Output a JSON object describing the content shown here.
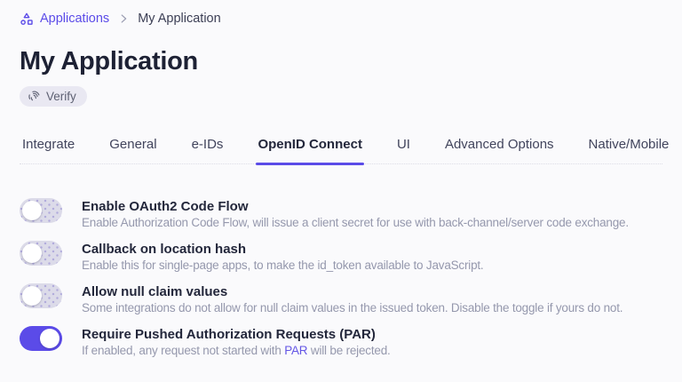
{
  "breadcrumb": {
    "root": "Applications",
    "current": "My Application"
  },
  "header": {
    "title": "My Application",
    "verify_button": "Verify"
  },
  "tabs": [
    {
      "label": "Integrate",
      "active": false
    },
    {
      "label": "General",
      "active": false
    },
    {
      "label": "e-IDs",
      "active": false
    },
    {
      "label": "OpenID Connect",
      "active": true
    },
    {
      "label": "UI",
      "active": false
    },
    {
      "label": "Advanced Options",
      "active": false
    },
    {
      "label": "Native/Mobile",
      "active": false
    }
  ],
  "settings": [
    {
      "label": "Enable OAuth2 Code Flow",
      "description": "Enable Authorization Code Flow, will issue a client secret for use with back-channel/server code exchange.",
      "enabled": false
    },
    {
      "label": "Callback on location hash",
      "description": "Enable this for single-page apps, to make the id_token available to JavaScript.",
      "enabled": false
    },
    {
      "label": "Allow null claim values",
      "description": "Some integrations do not allow for null claim values in the issued token. Disable the toggle if yours do not.",
      "enabled": false
    },
    {
      "label": "Require Pushed Authorization Requests (PAR)",
      "description_prefix": "If enabled, any request not started with ",
      "description_link": "PAR",
      "description_suffix": " will be rejected.",
      "enabled": true
    }
  ],
  "colors": {
    "accent": "#5b4be8",
    "link": "#6456e5",
    "page_background": "#fafafc",
    "title_text": "#1d2134",
    "description_text": "#9598ad",
    "badge_background": "#e9e8f2",
    "toggle_off_track": "#dcdbe9"
  }
}
